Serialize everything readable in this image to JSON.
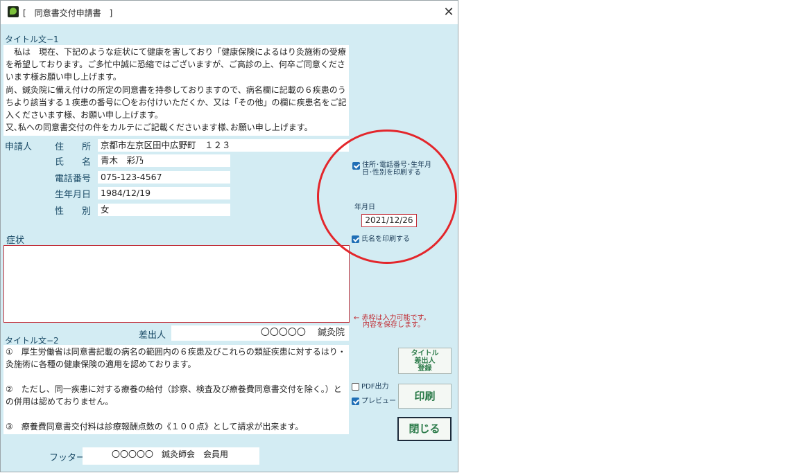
{
  "window": {
    "title": "[　同意書交付申請書　]",
    "close_glyph": "✕"
  },
  "section1": {
    "label": "タイトル文−1",
    "lines": [
      "　私は　現在、下記のような症状にて健康を害しており「健康保険によるはり灸施術の受療",
      "を希望しております。ご多忙中誠に恐縮ではございますが、ご高診の上、何卒ご同意くださ",
      "います様お願い申し上げます。",
      "尚、鍼灸院に備え付けの所定の同意書を持参しておりますので、病名欄に記載の６疾患のう",
      "ちより該当する１疾患の番号に〇をお付けいただくか、又は「その他」の欄に疾患名をご記",
      "入くださいます様、お願い申し上げます。",
      "又､私への同意書交付の件をカルテにご記載くださいます様､お願い申し上げます。"
    ]
  },
  "applicant": {
    "label": "申請人",
    "address_label": "住　　所",
    "address_value": "京都市左京区田中広野町　１２３",
    "name_label": "氏　　名",
    "name_value": "青木　彩乃",
    "phone_label": "電話番号",
    "phone_value": "075-123-4567",
    "birth_label": "生年月日",
    "birth_value": "1984/12/19",
    "gender_label": "性　　別",
    "gender_value": "女"
  },
  "symptom": {
    "label": "症状",
    "value": ""
  },
  "note": {
    "line1": "← 赤枠は入力可能です。",
    "line2": "内容を保存します。"
  },
  "sender": {
    "label": "差出人",
    "value": "〇〇〇〇〇　 鍼灸院"
  },
  "section2": {
    "label": "タイトル文−2",
    "lines": [
      "①　厚生労働省は同意書記載の病名の範囲内の６疾患及びこれらの類証疾患に対するはり・",
      "灸施術に各種の健康保険の適用を認めております。",
      "",
      "②　ただし、同一疾患に対する療養の給付（診察、検査及び療養費同意書交付を除く。）と",
      "の併用は認めておりません。",
      "",
      "③　療養費同意書交付料は診療報酬点数の《１００点》として請求が出来ます。"
    ]
  },
  "footer": {
    "label": "フッター",
    "value": "〇〇〇〇〇　鍼灸師会　会員用"
  },
  "options": {
    "print_personal_label_1": "住所･電話番号･生年月",
    "print_personal_label_2": "日･性別を印刷する",
    "print_personal_checked": true,
    "date_label": "年月日",
    "date_value": "2021/12/26",
    "print_name_label": "氏名を印刷する",
    "print_name_checked": true,
    "pdf_label": "PDF出力",
    "pdf_checked": false,
    "preview_label": "プレビュー",
    "preview_checked": true
  },
  "buttons": {
    "title_sender_register_1": "タイトル",
    "title_sender_register_2": "差出人",
    "title_sender_register_3": "登録",
    "print": "印刷",
    "close": "閉じる"
  },
  "colors": {
    "window_bg": "#d3ecf3",
    "required_border": "#c2303a",
    "annotation_circle": "#e3262b",
    "checkbox": "#1f6fb6",
    "button_text": "#2a7a48"
  }
}
